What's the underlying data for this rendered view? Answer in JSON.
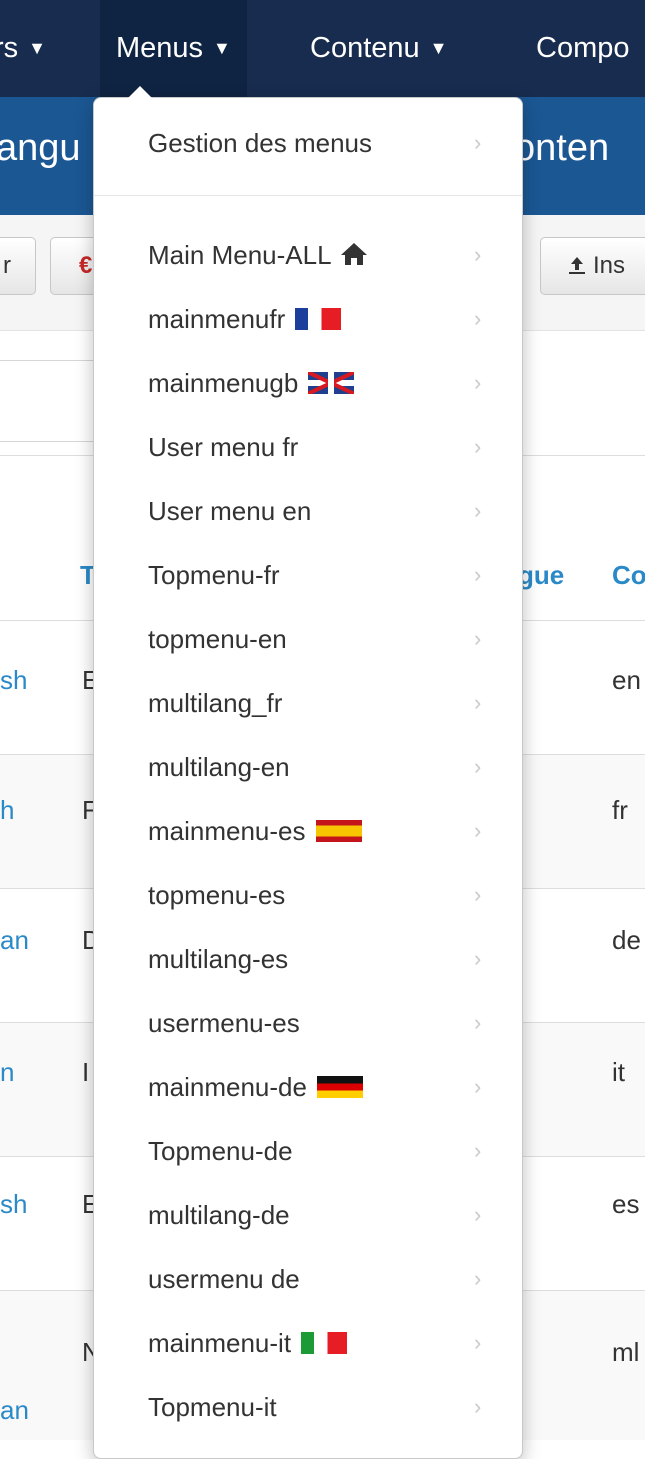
{
  "navbar": {
    "items": [
      {
        "label": "rs"
      },
      {
        "label": "Menus"
      },
      {
        "label": "Contenu"
      },
      {
        "label": "Compo"
      }
    ]
  },
  "header": {
    "left_text": "angu",
    "right_text": "onten"
  },
  "toolbar": {
    "left_btn_label": "r",
    "mid_btn_label": "€",
    "right_btn_label": "Ins"
  },
  "table": {
    "headers": {
      "left": "T",
      "lang": "gue",
      "code": "Co"
    },
    "rows": [
      {
        "link": "sh",
        "text": "E",
        "code": "en"
      },
      {
        "link": "h",
        "text": "F",
        "code": "fr"
      },
      {
        "link": "an",
        "text": "D",
        "code": "de"
      },
      {
        "link": "n",
        "text": "I",
        "code": "it"
      },
      {
        "link": "sh",
        "text": "E",
        "code": "es"
      },
      {
        "link": "an",
        "text": "N",
        "code": "ml"
      }
    ]
  },
  "dropdown": {
    "header_item": "Gestion des menus",
    "items": [
      {
        "label": "Main Menu-ALL",
        "icon": "home"
      },
      {
        "label": "mainmenufr",
        "flag": "fr"
      },
      {
        "label": "mainmenugb",
        "flag": "gb"
      },
      {
        "label": "User menu fr"
      },
      {
        "label": "User menu en"
      },
      {
        "label": "Topmenu-fr"
      },
      {
        "label": "topmenu-en"
      },
      {
        "label": "multilang_fr"
      },
      {
        "label": "multilang-en"
      },
      {
        "label": "mainmenu-es",
        "flag": "es"
      },
      {
        "label": "topmenu-es"
      },
      {
        "label": "multilang-es"
      },
      {
        "label": "usermenu-es"
      },
      {
        "label": "mainmenu-de",
        "flag": "de"
      },
      {
        "label": "Topmenu-de"
      },
      {
        "label": "multilang-de"
      },
      {
        "label": "usermenu de"
      },
      {
        "label": "mainmenu-it",
        "flag": "it"
      },
      {
        "label": "Topmenu-it"
      }
    ]
  },
  "colors": {
    "navbar": "#172c4e",
    "header": "#1b5793",
    "link": "#2a89c7"
  }
}
